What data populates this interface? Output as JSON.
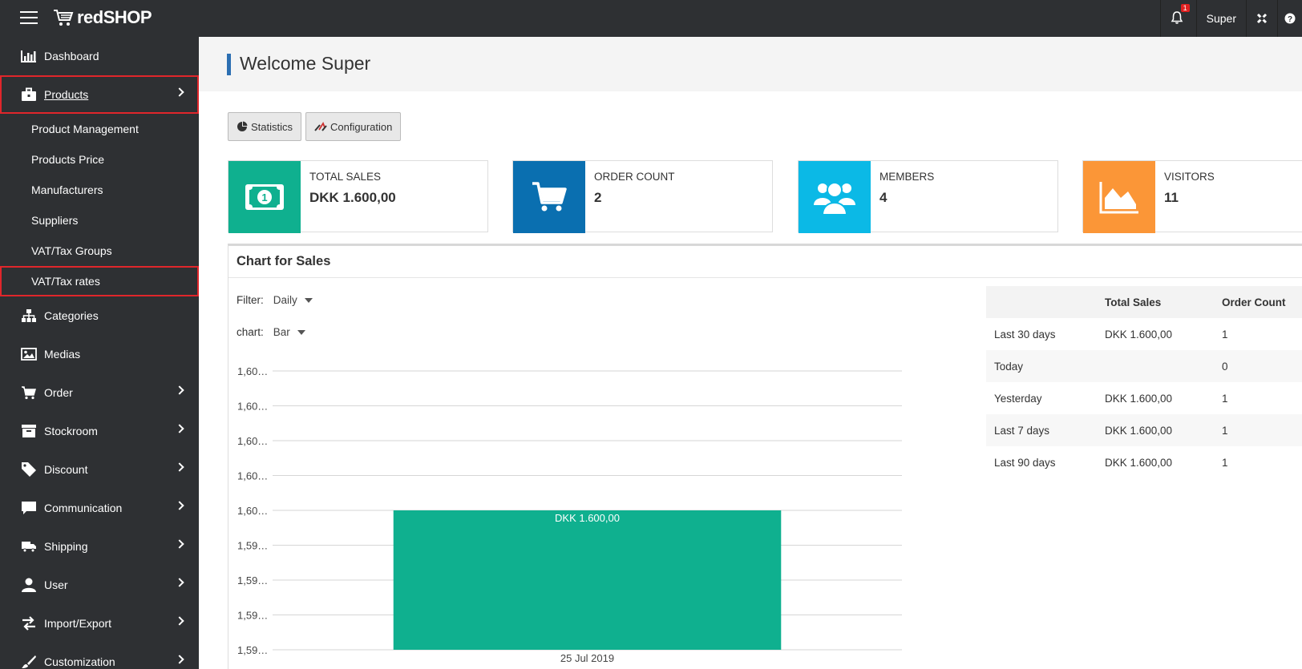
{
  "header": {
    "brand": "redSHOP",
    "notifications_count": "1",
    "user_name": "Super"
  },
  "sidebar": {
    "items": [
      {
        "label": "Dashboard",
        "icon": "bar-chart-icon"
      },
      {
        "label": "Products",
        "icon": "briefcase-icon"
      },
      {
        "label": "Categories",
        "icon": "sitemap-icon"
      },
      {
        "label": "Medias",
        "icon": "image-icon"
      },
      {
        "label": "Order",
        "icon": "cart-icon"
      },
      {
        "label": "Stockroom",
        "icon": "archive-icon"
      },
      {
        "label": "Discount",
        "icon": "tag-icon"
      },
      {
        "label": "Communication",
        "icon": "comment-icon"
      },
      {
        "label": "Shipping",
        "icon": "truck-icon"
      },
      {
        "label": "User",
        "icon": "user-icon"
      },
      {
        "label": "Import/Export",
        "icon": "exchange-icon"
      },
      {
        "label": "Customization",
        "icon": "brush-icon"
      }
    ],
    "product_sub": [
      "Product Management",
      "Products Price",
      "Manufacturers",
      "Suppliers",
      "VAT/Tax Groups",
      "VAT/Tax rates"
    ]
  },
  "main": {
    "welcome": "Welcome Super",
    "buttons": {
      "statistics": "Statistics",
      "configuration": "Configuration"
    },
    "stats": [
      {
        "label": "TOTAL SALES",
        "value": "DKK 1.600,00",
        "color": "#0fb08f",
        "icon": "money-icon"
      },
      {
        "label": "ORDER COUNT",
        "value": "2",
        "color": "#0a6fb0",
        "icon": "cart-icon"
      },
      {
        "label": "MEMBERS",
        "value": "4",
        "color": "#0bb9e6",
        "icon": "users-icon"
      },
      {
        "label": "VISITORS",
        "value": "11",
        "color": "#fb9637",
        "icon": "area-chart-icon"
      }
    ],
    "chart_panel": {
      "title": "Chart for Sales",
      "filter_label": "Filter:",
      "filter_value": "Daily",
      "chart_label": "chart:",
      "chart_value": "Bar"
    },
    "summary": {
      "headers": [
        "",
        "Total Sales",
        "Order Count"
      ],
      "rows": [
        [
          "Last 30 days",
          "DKK 1.600,00",
          "1"
        ],
        [
          "Today",
          "",
          "0"
        ],
        [
          "Yesterday",
          "DKK 1.600,00",
          "1"
        ],
        [
          "Last 7 days",
          "DKK 1.600,00",
          "1"
        ],
        [
          "Last 90 days",
          "DKK 1.600,00",
          "1"
        ]
      ]
    }
  },
  "chart_data": {
    "type": "bar",
    "categories": [
      "25 Jul 2019"
    ],
    "values": [
      1600
    ],
    "data_labels": [
      "DKK 1.600,00"
    ],
    "y_tick_labels": [
      "1,60…",
      "1,60…",
      "1,60…",
      "1,60…",
      "1,60…",
      "1,59…",
      "1,59…",
      "1,59…",
      "1,59…"
    ],
    "bar_color": "#0fb08f",
    "grid": true
  }
}
